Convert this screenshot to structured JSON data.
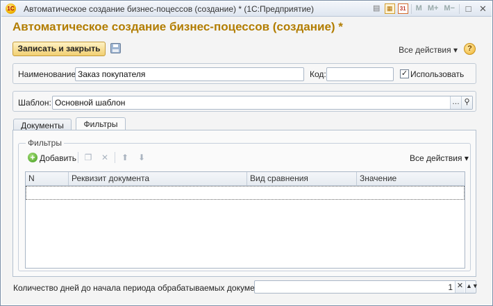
{
  "window": {
    "title": "Автоматическое создание бизнес-поцессов (создание) *  (1С:Предприятие)",
    "app_icon_text": "1С",
    "toolbar_icons": [
      "doc-icon",
      "calculator-icon",
      "calendar-icon"
    ],
    "calendar_number": "31",
    "memory_buttons": [
      "M",
      "M+",
      "M−"
    ],
    "win_controls": [
      "□",
      "✕"
    ]
  },
  "form": {
    "title": "Автоматическое создание бизнес-поцессов (создание) *",
    "save_close_label": "Записать и закрыть",
    "all_actions_label": "Все действия",
    "help_label": "?"
  },
  "fields": {
    "name_label": "Наименование:",
    "name_value": "Заказ покупателя",
    "code_label": "Код:",
    "code_value": "",
    "use_label": "Использовать",
    "use_checked": true,
    "template_label": "Шаблон:",
    "template_value": "Основной шаблон"
  },
  "tabs": [
    {
      "label": "Документы",
      "active": false
    },
    {
      "label": "Фильтры",
      "active": true
    }
  ],
  "filters": {
    "legend": "Фильтры",
    "add_label": "Добавить",
    "all_actions_label": "Все действия",
    "columns": [
      "N",
      "Реквизит документа",
      "Вид сравнения",
      "Значение"
    ],
    "rows": []
  },
  "footer": {
    "days_label": "Количество дней до начала периода обрабатываемых документов:",
    "days_value": "1"
  },
  "colors": {
    "title_color": "#b27d00",
    "save_button": "#f1cf72"
  }
}
